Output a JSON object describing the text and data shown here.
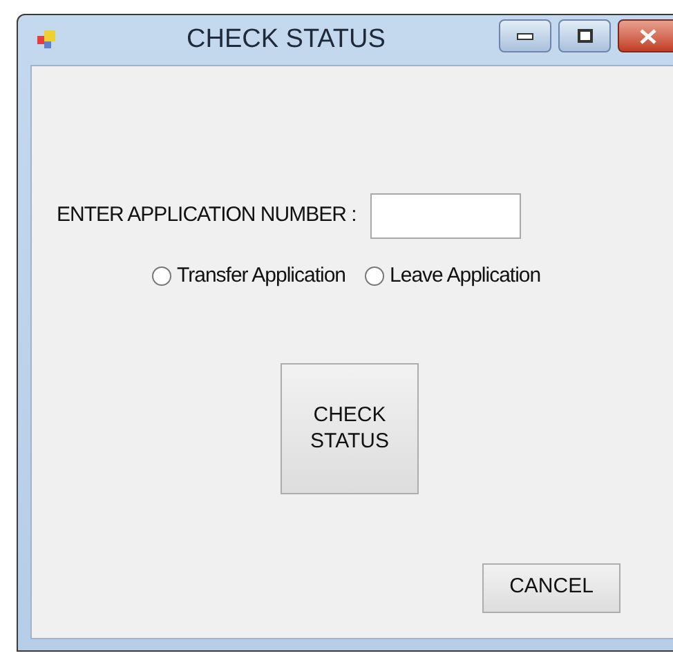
{
  "window": {
    "title": "CHECK STATUS"
  },
  "application_number": {
    "label": "ENTER APPLICATION NUMBER :"
  },
  "radios": [
    {
      "label": "Transfer Application",
      "selected": false
    },
    {
      "label": "Leave Application",
      "selected": false
    }
  ],
  "buttons": {
    "check": {
      "lines": [
        "CHECK",
        "STATUS"
      ]
    },
    "cancel": "CANCEL"
  }
}
